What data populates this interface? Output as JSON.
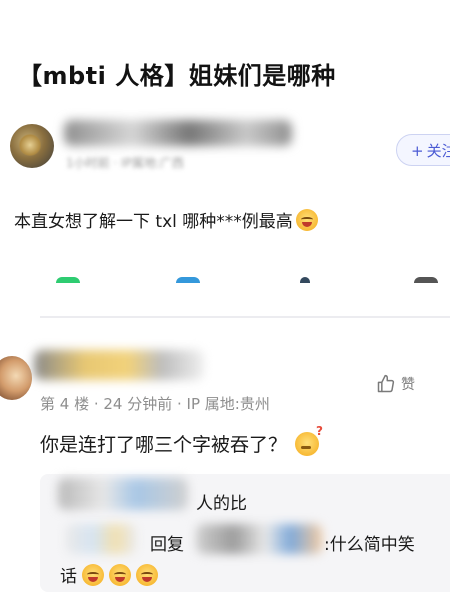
{
  "post": {
    "title": "【mbti 人格】姐妹们是哪种",
    "author_meta": "1小时前 · IP属地:广西",
    "follow_label": "关注",
    "follow_prefix": "+",
    "body": "本直女想了解一下 txl 哪种***例最高"
  },
  "reply": {
    "meta": "第 4 楼 · 24 分钟前 · IP 属地:贵州",
    "like_label": "赞",
    "body": "你是连打了哪三个字被吞了？",
    "quote": {
      "line1": "人的比",
      "reply_label": "回复",
      "line2": ":什么简中笑",
      "line3": "话"
    }
  },
  "colors": {
    "accent": "#4b5bd4",
    "meta_gray": "#8e8e8e",
    "quote_bg": "#f5f5f7",
    "action_dots": [
      "#2ecc71",
      "#3498db",
      "#34495e",
      "#555555"
    ]
  },
  "icons": {
    "like": "thumbs-up-icon",
    "emoji_laugh": "laughing-face-icon",
    "emoji_think": "thinking-face-icon"
  }
}
